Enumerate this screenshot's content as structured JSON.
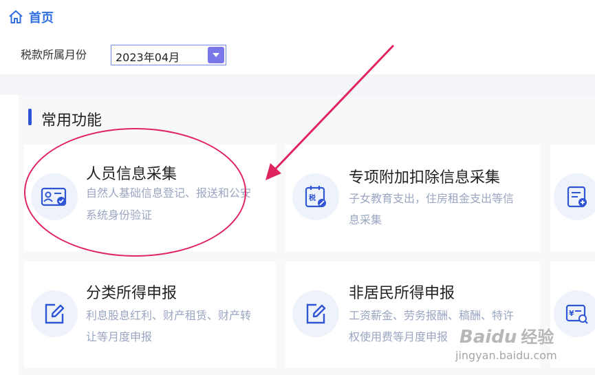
{
  "nav": {
    "home_label": "首页"
  },
  "filter": {
    "label": "税款所属月份",
    "selected": "2023年04月"
  },
  "section": {
    "title": "常用功能"
  },
  "cards": [
    {
      "title": "人员信息采集",
      "desc_1": "自然人基础信息登记、报送和公安",
      "desc_2": "系统身份验证",
      "icon": "id-card-icon"
    },
    {
      "title": "专项附加扣除信息采集",
      "desc_1": "子女教育支出，住房租金支出等信",
      "desc_2": "息采集",
      "icon": "tax-form-icon"
    },
    {
      "title": "分类所得申报",
      "desc_1": "利息股息红利、财产租赁、财产转",
      "desc_2": "让等月度申报",
      "icon": "edit-icon"
    },
    {
      "title": "非居民所得申报",
      "desc_1": "工资薪金、劳务报酬、稿酬、特许",
      "desc_2": "权使用费等月度申报",
      "icon": "edit-icon"
    }
  ],
  "watermark": {
    "brand": "Bai",
    "brand2": "du",
    "suffix": "经验",
    "url": "jingyan.baidu.com"
  },
  "colors": {
    "primary": "#2f55d4",
    "annotation": "#e0245e",
    "select_arrow": "#7a78e8"
  }
}
